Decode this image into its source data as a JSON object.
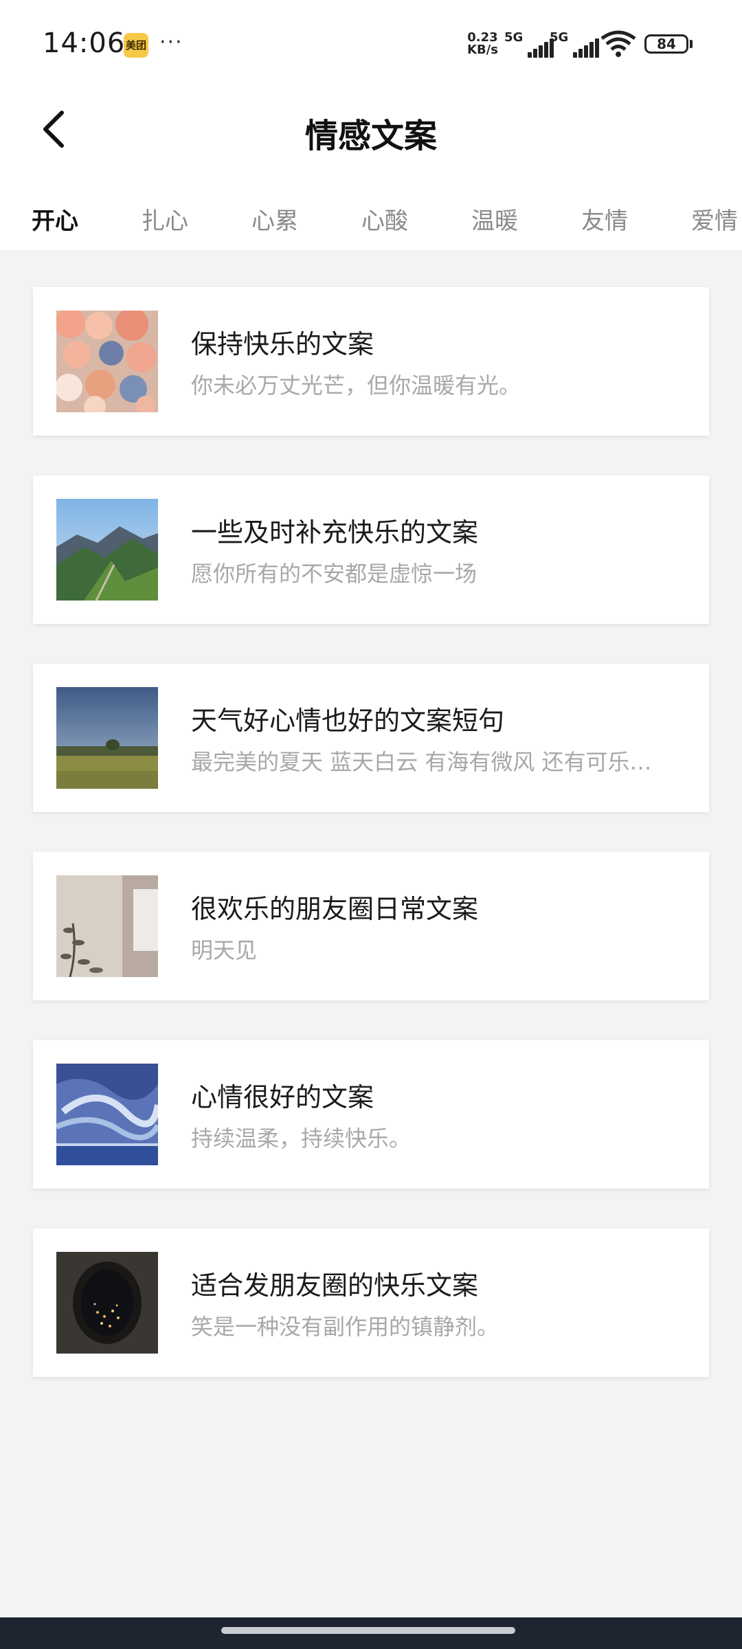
{
  "status": {
    "time": "14:06",
    "app_badge": "美团",
    "more": "···",
    "net_speed_value": "0.23",
    "net_speed_unit": "KB/s",
    "signal1_label": "5G",
    "signal2_label": "5G",
    "battery": "84"
  },
  "header": {
    "title": "情感文案"
  },
  "tabs": [
    {
      "label": "开心",
      "active": true
    },
    {
      "label": "扎心"
    },
    {
      "label": "心累"
    },
    {
      "label": "心酸"
    },
    {
      "label": "温暖"
    },
    {
      "label": "友情"
    },
    {
      "label": "爱情"
    }
  ],
  "cards": [
    {
      "title": "保持快乐的文案",
      "subtitle": "你未必万丈光芒，但你温暖有光。",
      "thumb": "flowers-image"
    },
    {
      "title": "一些及时补充快乐的文案",
      "subtitle": "愿你所有的不安都是虚惊一场",
      "thumb": "mountain-image"
    },
    {
      "title": "天气好心情也好的文案短句",
      "subtitle": "最完美的夏天 蓝天白云 有海有微风 还有可乐…",
      "thumb": "field-sky-image"
    },
    {
      "title": "很欢乐的朋友圈日常文案",
      "subtitle": "明天见",
      "thumb": "room-plant-image"
    },
    {
      "title": "心情很好的文案",
      "subtitle": "持续温柔，持续快乐。",
      "thumb": "painted-sky-image"
    },
    {
      "title": "适合发朋友圈的快乐文案",
      "subtitle": "笑是一种没有副作用的镇静剂。",
      "thumb": "plane-window-image"
    }
  ],
  "colors": {
    "background": "#f3f3f4",
    "active_tab": "#111111",
    "inactive_tab": "#8a8a8a",
    "subtitle": "#a8a8a8"
  }
}
